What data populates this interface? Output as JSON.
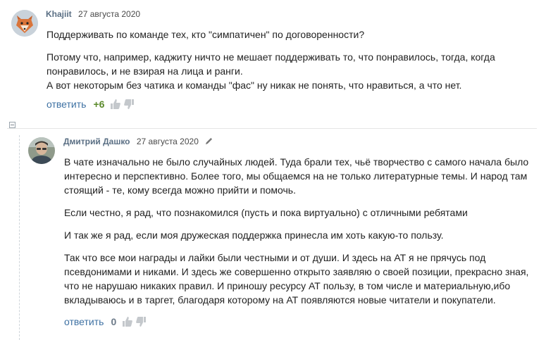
{
  "comments": [
    {
      "author": "Khajiit",
      "date": "27 августа 2020",
      "paragraphs": [
        [
          "Поддерживать по команде тех, кто \"симпатичен\" по договоренности?"
        ],
        [
          "Потому что, например, каджиту ничто не мешает поддерживать то, что понравилось, тогда, когда",
          "понравилось, и не взирая на лица и ранги.",
          "А вот некоторым без чатика и команды \"фас\" ну никак не понять, что нравиться, а что нет."
        ]
      ],
      "reply_label": "ответить",
      "score": "+6",
      "avatar_icon": "fox-avatar-icon"
    },
    {
      "author": "Дмитрий Дашко",
      "date": "27 августа 2020",
      "editable_icon": "pencil-icon",
      "paragraphs": [
        [
          "В чате изначально не было случайных людей. Туда брали тех, чьё творчество с самого начала было",
          "интересно и перспективно. Более того, мы общаемся на не только литературные темы. И народ там",
          "стоящий - те, кому всегда можно прийти и помочь."
        ],
        [
          "Если честно, я рад, что познакомился (пусть и пока виртуально) с отличными ребятами"
        ],
        [
          "И так же я рад, если моя дружеская поддержка принесла им хоть какую-то пользу."
        ],
        [
          "Так что все мои награды и лайки были честными и от души. И здесь на АТ я не прячусь под",
          "псевдонимами и никами. И здесь же совершенно открыто заявляю о своей позиции, прекрасно зная,",
          "что не нарушаю никаких правил. И приношу ресурсу АТ пользу, в том числе и материальную,ибо",
          "вкладываюсь и в таргет, благодаря которому на АТ появляются новые читатели и покупатели."
        ]
      ],
      "reply_label": "ответить",
      "score": "0",
      "avatar_icon": "user-photo-avatar-icon"
    }
  ],
  "colors": {
    "author": "#5a6f84",
    "reply": "#3e71a3",
    "score_positive": "#5a8a2a",
    "score_zero": "#6c7a89"
  }
}
